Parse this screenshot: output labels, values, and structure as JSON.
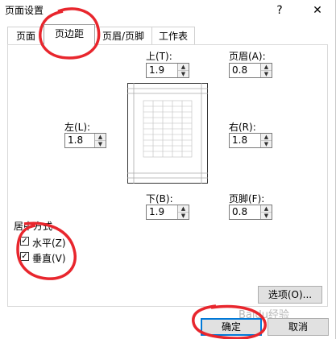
{
  "dialog": {
    "title": "页面设置",
    "help_label": "?",
    "close_label": "✕"
  },
  "tabs": [
    {
      "label": "页面",
      "active": false
    },
    {
      "label": "页边距",
      "active": true
    },
    {
      "label": "页眉/页脚",
      "active": false
    },
    {
      "label": "工作表",
      "active": false
    }
  ],
  "margins": {
    "top": {
      "label": "上(T):",
      "value": "1.9"
    },
    "header": {
      "label": "页眉(A):",
      "value": "0.8"
    },
    "left": {
      "label": "左(L):",
      "value": "1.8"
    },
    "right": {
      "label": "右(R):",
      "value": "1.8"
    },
    "bottom": {
      "label": "下(B):",
      "value": "1.9"
    },
    "footer": {
      "label": "页脚(F):",
      "value": "0.8"
    }
  },
  "centering": {
    "group_label": "居中方式",
    "horizontal": {
      "label": "水平(Z)",
      "checked": true
    },
    "vertical": {
      "label": "垂直(V)",
      "checked": true
    }
  },
  "buttons": {
    "options": "选项(O)...",
    "ok": "确定",
    "cancel": "取消"
  },
  "watermark": "Baidu经验",
  "annotation_color": "#e8262d",
  "accent_color": "#0078d7"
}
